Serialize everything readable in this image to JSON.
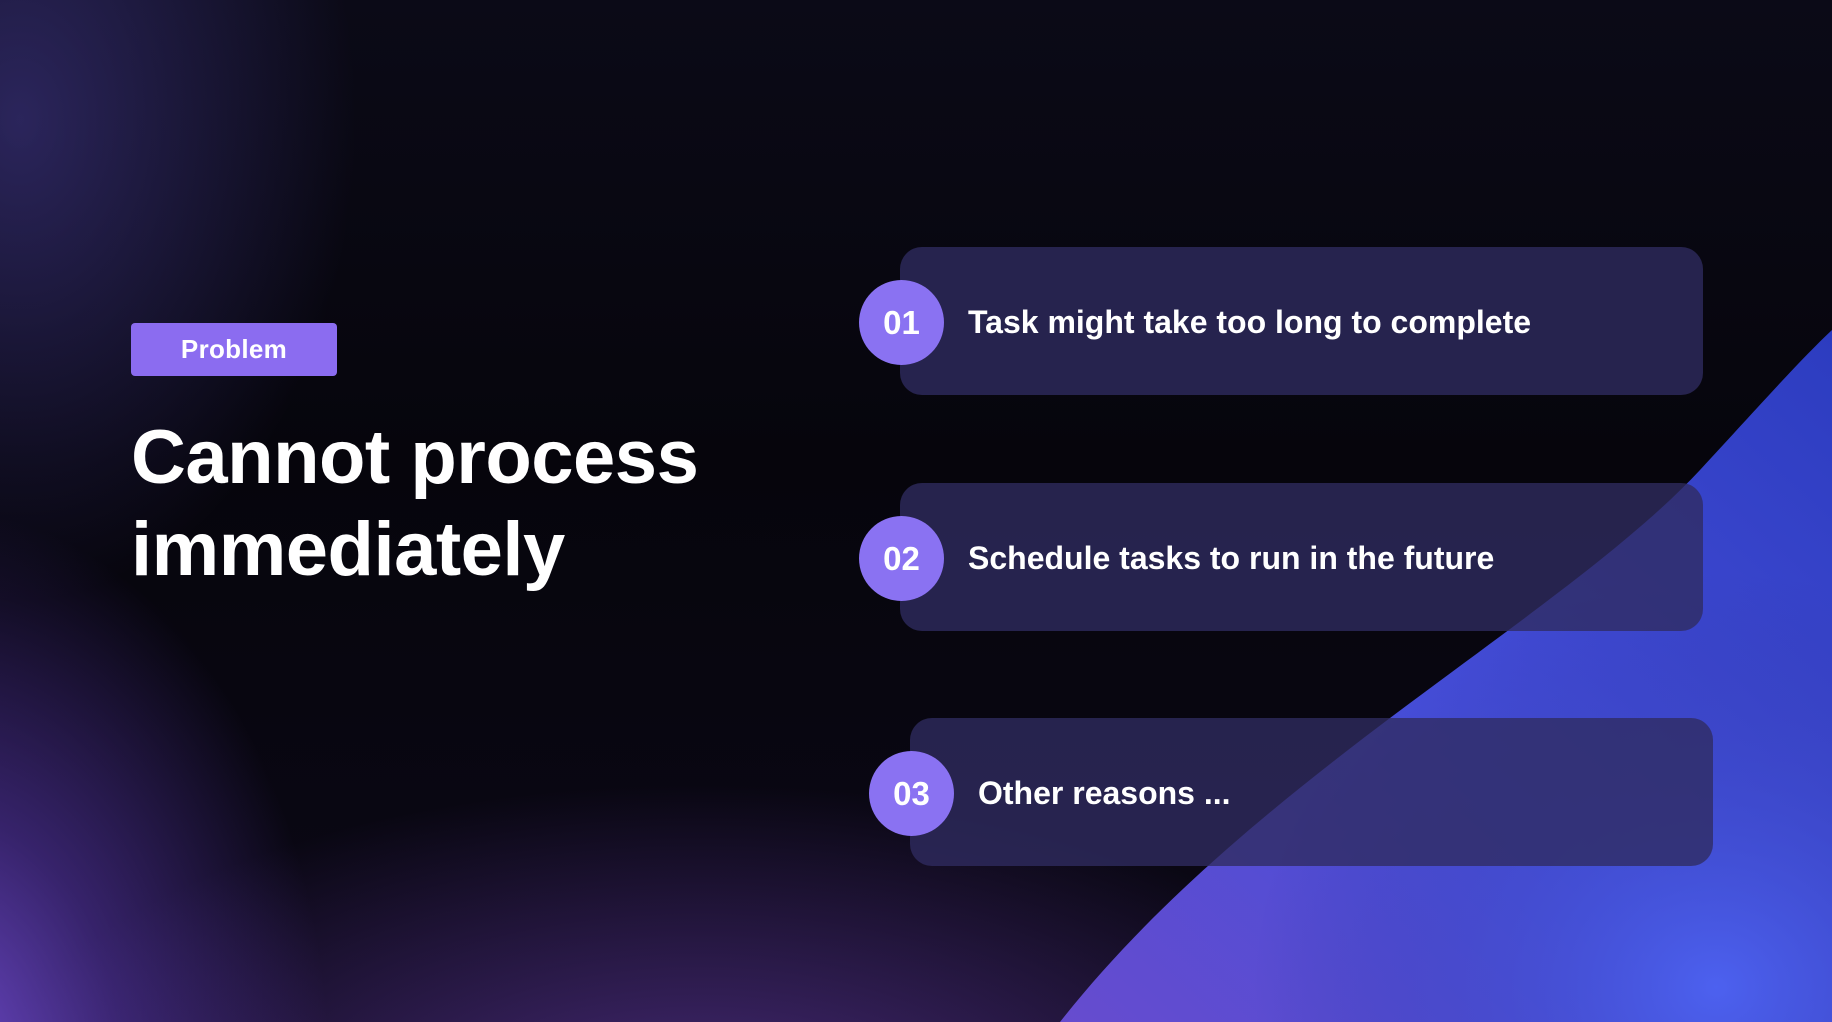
{
  "slide": {
    "tag_label": "Problem",
    "title_line1": "Cannot process",
    "title_line2": "immediately"
  },
  "items": [
    {
      "number": "01",
      "text": "Task might take too long to complete"
    },
    {
      "number": "02",
      "text": "Schedule tasks to run in the future"
    },
    {
      "number": "03",
      "text": "Other reasons ..."
    }
  ],
  "colors": {
    "accent": "#8b6cf0",
    "bubble": "#8a72f2",
    "card": "#302c60",
    "background": "#07060e",
    "blue_sweep": "#3f56e0"
  }
}
